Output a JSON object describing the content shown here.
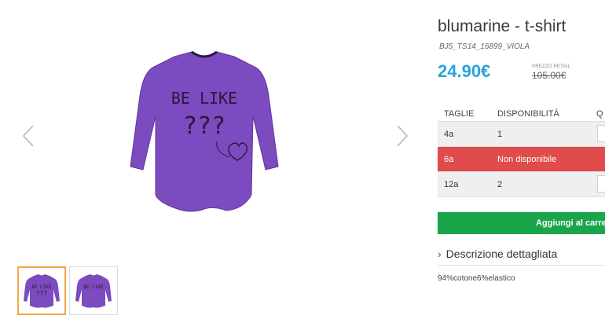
{
  "gallery": {
    "prev_icon": "chevron-left-icon",
    "next_icon": "chevron-right-icon",
    "main_image_text_1": "BE LIKE",
    "main_image_text_2": "???",
    "thumb_back_text": "BE LIKE"
  },
  "product": {
    "title": "blumarine - t-shirt",
    "sku": "BJ5_TS14_16899_VIOLA",
    "price": "24.90€",
    "retail_label": "PREZZO RETAIL",
    "retail_price": "105.00€",
    "accent_color": "#29a3d9",
    "shirt_color": "#7b4bbf"
  },
  "table": {
    "headers": [
      "TAGLIE",
      "DISPONIBILITÀ",
      "Q"
    ],
    "rows": [
      {
        "size": "4a",
        "availability": "1"
      },
      {
        "size": "6a",
        "availability": "Non disponibile"
      },
      {
        "size": "12a",
        "availability": "2"
      }
    ]
  },
  "cart": {
    "label": "Aggiungi al carrello",
    "color": "#1aa54a"
  },
  "description": {
    "toggle_label": "Descrizione dettagliata",
    "text": "94%cotone6%elastico"
  }
}
